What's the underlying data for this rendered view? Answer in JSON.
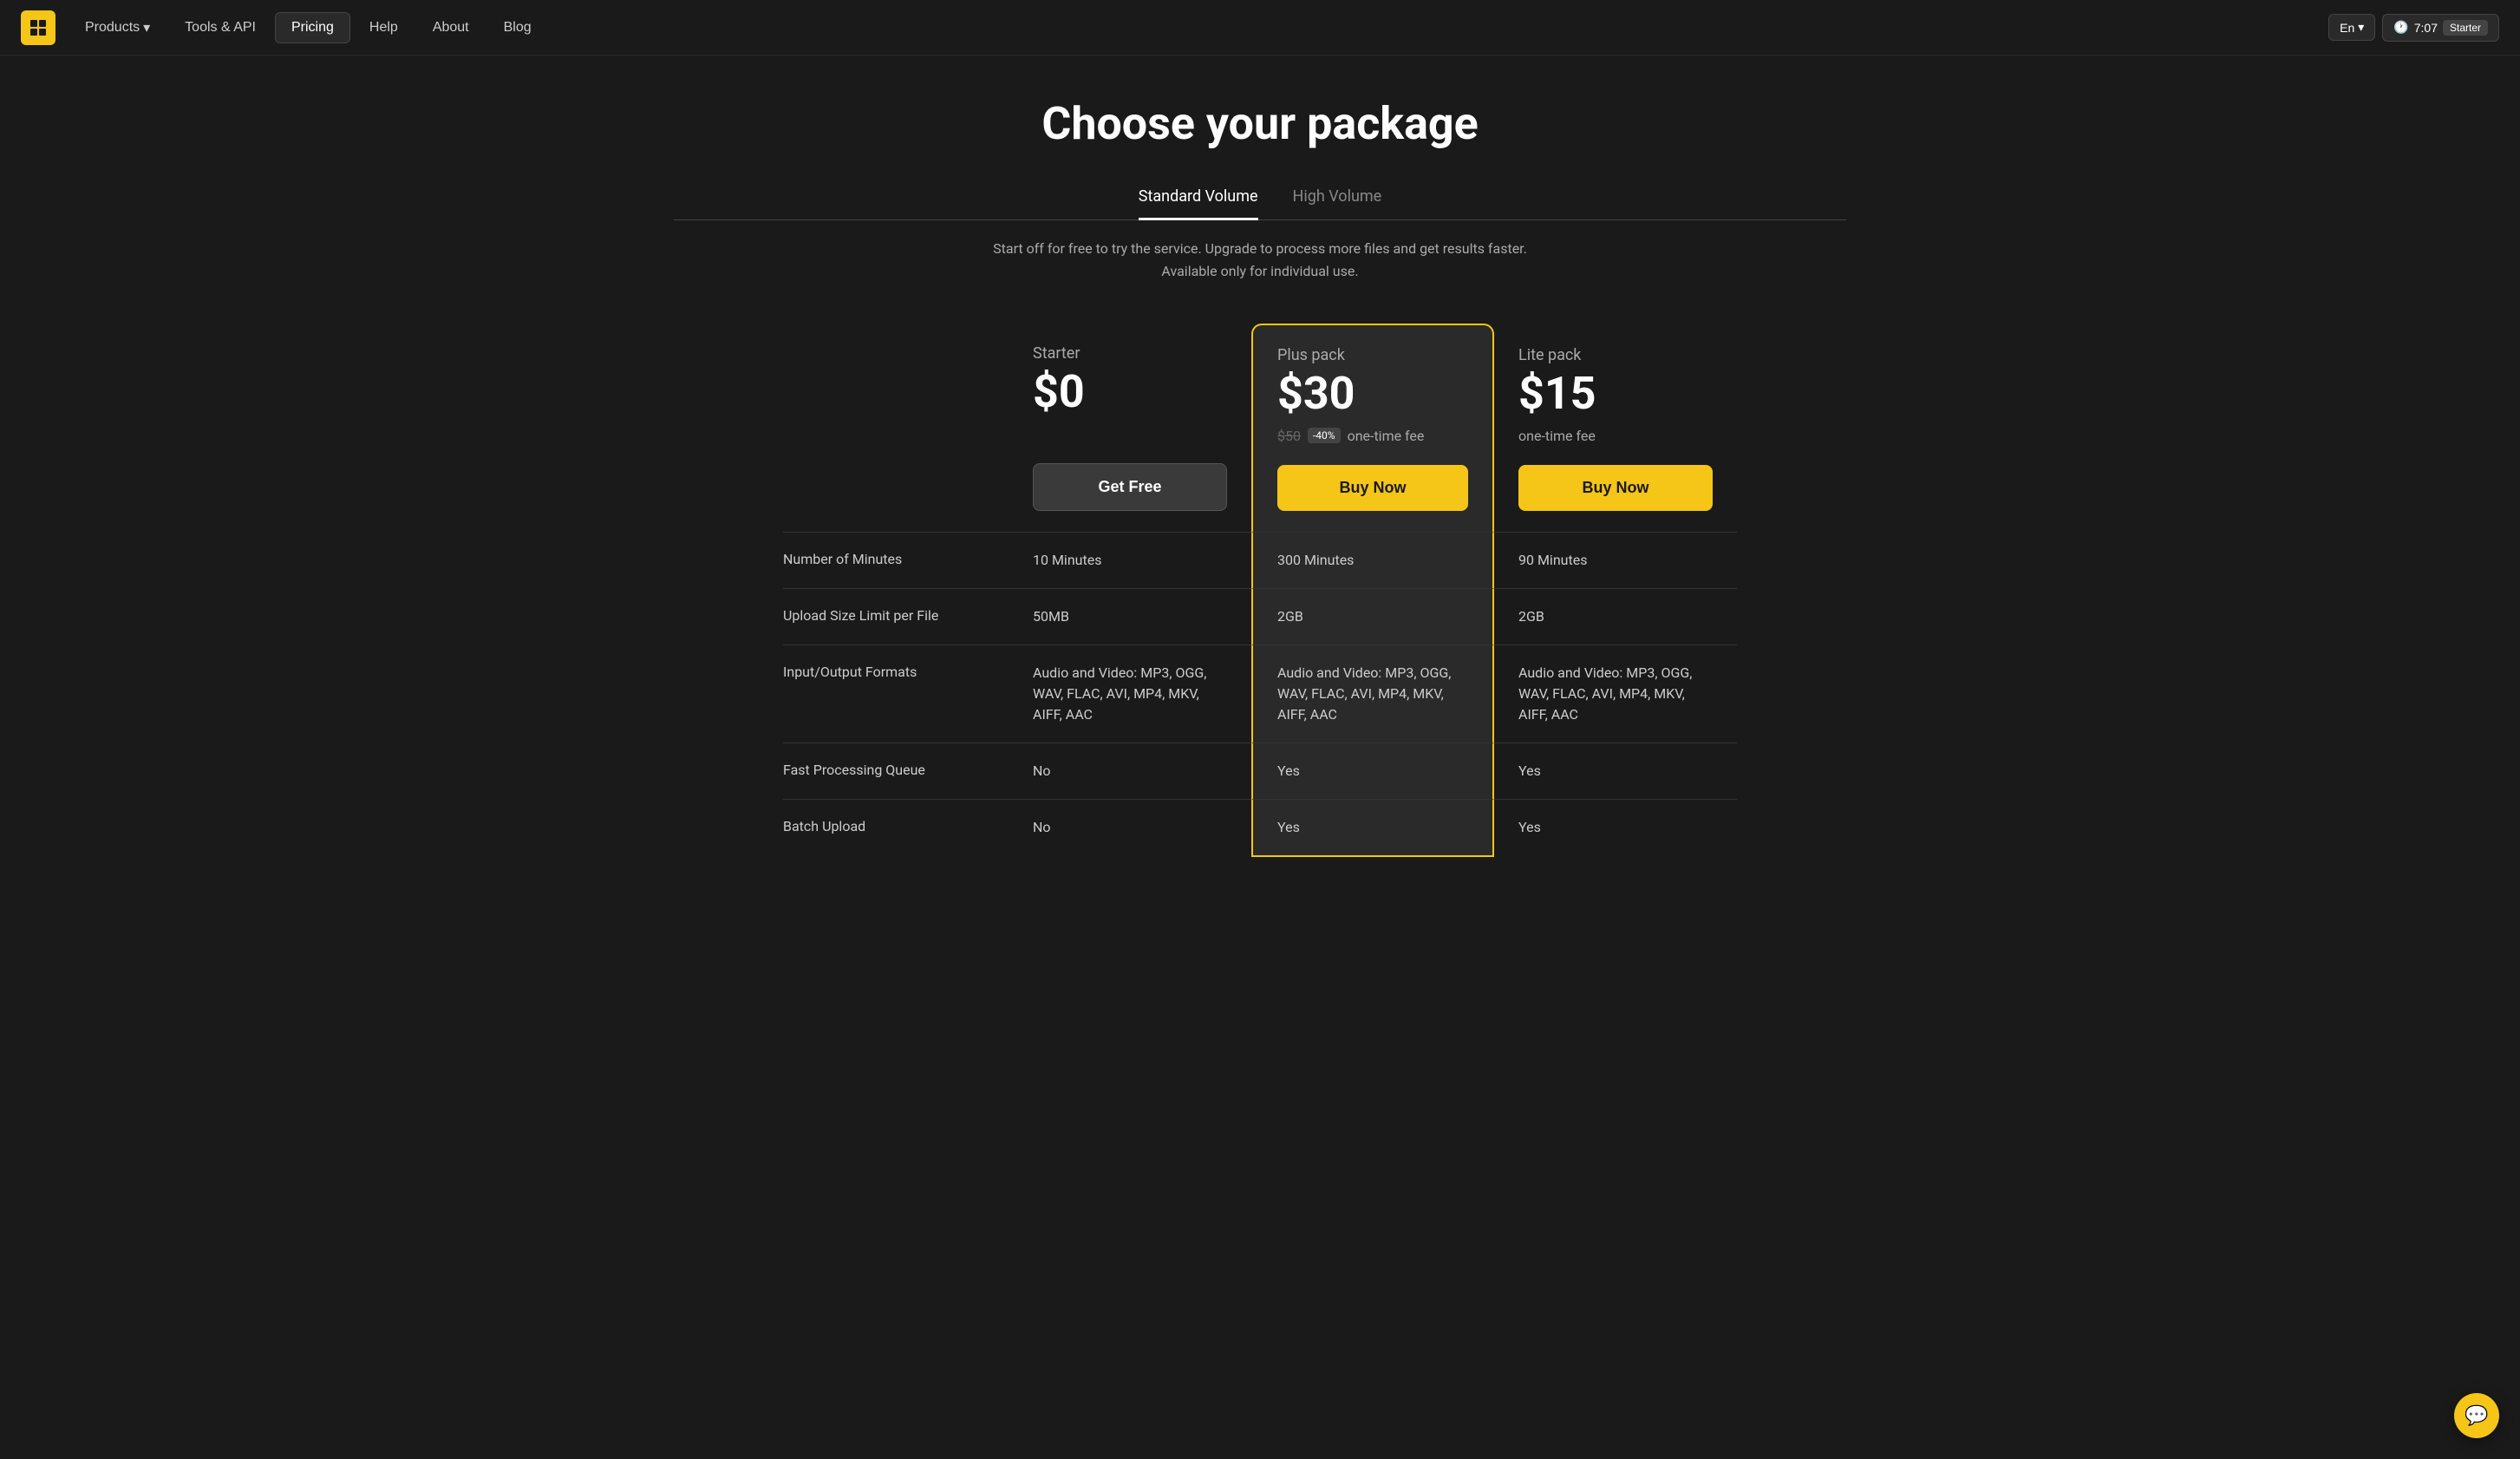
{
  "nav": {
    "logo_alt": "Logo",
    "links": [
      {
        "label": "Products",
        "id": "products",
        "active": false,
        "has_dropdown": true
      },
      {
        "label": "Tools & API",
        "id": "tools-api",
        "active": false,
        "has_dropdown": false
      },
      {
        "label": "Pricing",
        "id": "pricing",
        "active": true,
        "has_dropdown": false
      },
      {
        "label": "Help",
        "id": "help",
        "active": false,
        "has_dropdown": false
      },
      {
        "label": "About",
        "id": "about",
        "active": false,
        "has_dropdown": false
      },
      {
        "label": "Blog",
        "id": "blog",
        "active": false,
        "has_dropdown": false
      }
    ],
    "lang": "En",
    "timer": "7:07",
    "user_badge": "Starter"
  },
  "page": {
    "title": "Choose your package",
    "subtitle": "Start off for free to try the service. Upgrade to process more files and get results faster. Available only for individual use."
  },
  "tabs": [
    {
      "label": "Standard Volume",
      "id": "standard",
      "active": true
    },
    {
      "label": "High Volume",
      "id": "high",
      "active": false
    }
  ],
  "plans": [
    {
      "id": "starter",
      "name": "Starter",
      "price": "$0",
      "price_details": "",
      "original_price": "",
      "discount": "",
      "one_time": "",
      "btn_label": "Get Free",
      "btn_type": "free",
      "featured": false
    },
    {
      "id": "plus",
      "name": "Plus pack",
      "price": "$30",
      "original_price": "$50",
      "discount": "-40%",
      "one_time": "one-time fee",
      "btn_label": "Buy Now",
      "btn_type": "paid",
      "featured": true
    },
    {
      "id": "lite",
      "name": "Lite pack",
      "price": "$15",
      "original_price": "",
      "discount": "",
      "one_time": "one-time fee",
      "btn_label": "Buy Now",
      "btn_type": "paid",
      "featured": false
    }
  ],
  "features": [
    {
      "label": "Number of Minutes",
      "values": [
        "10 Minutes",
        "300 Minutes",
        "90 Minutes"
      ]
    },
    {
      "label": "Upload Size Limit per File",
      "values": [
        "50MB",
        "2GB",
        "2GB"
      ]
    },
    {
      "label": "Input/Output Formats",
      "values": [
        "Audio and Video: MP3, OGG, WAV, FLAC, AVI, MP4, MKV, AIFF, AAC",
        "Audio and Video: MP3, OGG, WAV, FLAC, AVI, MP4, MKV, AIFF, AAC",
        "Audio and Video: MP3, OGG, WAV, FLAC, AVI, MP4, MKV, AIFF, AAC"
      ]
    },
    {
      "label": "Fast Processing Queue",
      "values": [
        "No",
        "Yes",
        "Yes"
      ]
    },
    {
      "label": "Batch Upload",
      "values": [
        "No",
        "Yes",
        "Yes"
      ]
    }
  ],
  "colors": {
    "accent": "#f5c518",
    "bg": "#1a1a1a",
    "card_bg": "#2a2a2a",
    "featured_border": "#f5c518"
  }
}
